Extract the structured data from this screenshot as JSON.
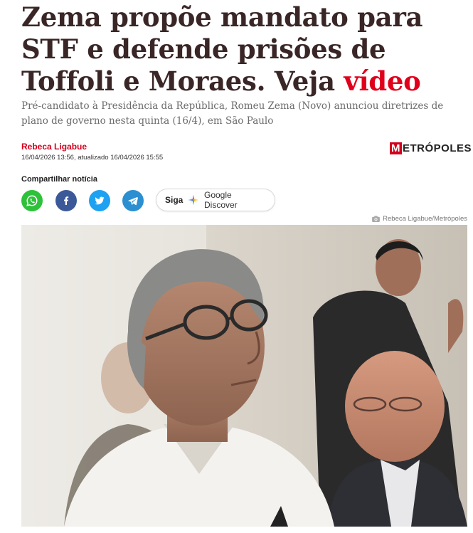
{
  "headline": {
    "part1": "Zema propõe mandato para STF e defende prisões de Toffoli e Moraes. Veja ",
    "part2": "vídeo"
  },
  "subtitle": "Pré-candidato à Presidência da República, Romeu Zema (Novo) anunciou diretrizes de plano de governo nesta quinta (16/4), em São Paulo",
  "author": "Rebeca Ligabue",
  "dates": "16/04/2026 13:56, atualizado 16/04/2026 15:55",
  "brand": {
    "first": "M",
    "rest": "ETRÓPOLES",
    "accent": "#d3001d"
  },
  "share": {
    "label": "Compartilhar notícia",
    "buttons": [
      {
        "name": "whatsapp",
        "icon": "whatsapp-icon",
        "color": "#2ec13a"
      },
      {
        "name": "facebook",
        "icon": "facebook-icon",
        "color": "#3b5998"
      },
      {
        "name": "twitter",
        "icon": "twitter-icon",
        "color": "#1da1f2"
      },
      {
        "name": "telegram",
        "icon": "telegram-icon",
        "color": "#2b8fd1"
      }
    ]
  },
  "follow": {
    "label": "Siga",
    "service": "Google Discover"
  },
  "photo": {
    "credit": "Rebeca Ligabue/Metrópoles",
    "icon": "camera-icon"
  }
}
